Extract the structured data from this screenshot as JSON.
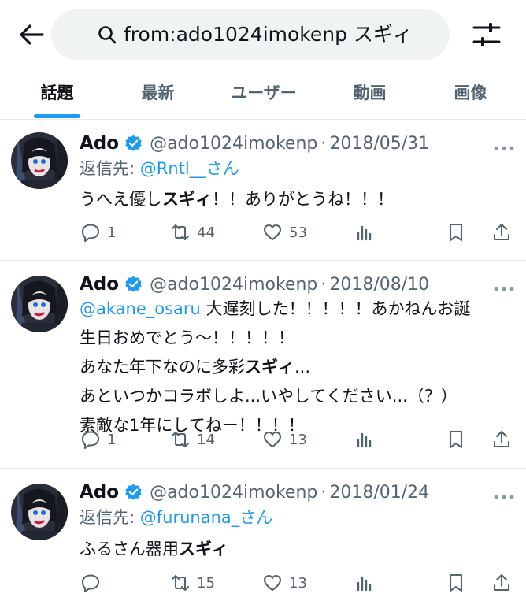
{
  "search": {
    "query": "from:ado1024imokenp スギィ"
  },
  "tabs": [
    {
      "label": "話題",
      "active": true
    },
    {
      "label": "最新",
      "active": false
    },
    {
      "label": "ユーザー",
      "active": false
    },
    {
      "label": "動画",
      "active": false
    },
    {
      "label": "画像",
      "active": false
    }
  ],
  "colors": {
    "accent": "#1d9bf0",
    "text": "#0f1419",
    "muted": "#536471"
  },
  "tweets": [
    {
      "name": "Ado",
      "handle": "@ado1024imokenp",
      "sep": "·",
      "date": "2018/05/31",
      "reply_prefix": "返信先: ",
      "reply_user": "@Rntl__さん",
      "lines": [
        {
          "pre": "うへえ優し",
          "bold": "スギィ",
          "post": "！！ありがとうね！！！"
        }
      ],
      "reply_count": "1",
      "retweet_count": "44",
      "like_count": "53"
    },
    {
      "name": "Ado",
      "handle": "@ado1024imokenp",
      "sep": "·",
      "date": "2018/08/10",
      "mention": "@akane_osaru",
      "lines": [
        {
          "pre": " 大遅刻した！！！！！あかねんお誕"
        },
        {
          "pre": "生日おめでとう〜！！！！！"
        },
        {
          "pre": "あなた年下なのに多彩",
          "bold": "スギィ",
          "post": "..."
        },
        {
          "pre": "あといつかコラボしよ...いやしてください...（？）"
        },
        {
          "pre": "素敵な1年にしてねー！！！！"
        }
      ],
      "reply_count": "1",
      "retweet_count": "14",
      "like_count": "13"
    },
    {
      "name": "Ado",
      "handle": "@ado1024imokenp",
      "sep": "·",
      "date": "2018/01/24",
      "reply_prefix": "返信先: ",
      "reply_user": "@furunana_さん",
      "lines": [
        {
          "pre": "ふるさん器用",
          "bold": "スギィ"
        }
      ],
      "reply_count": "",
      "retweet_count": "15",
      "like_count": "13"
    }
  ]
}
